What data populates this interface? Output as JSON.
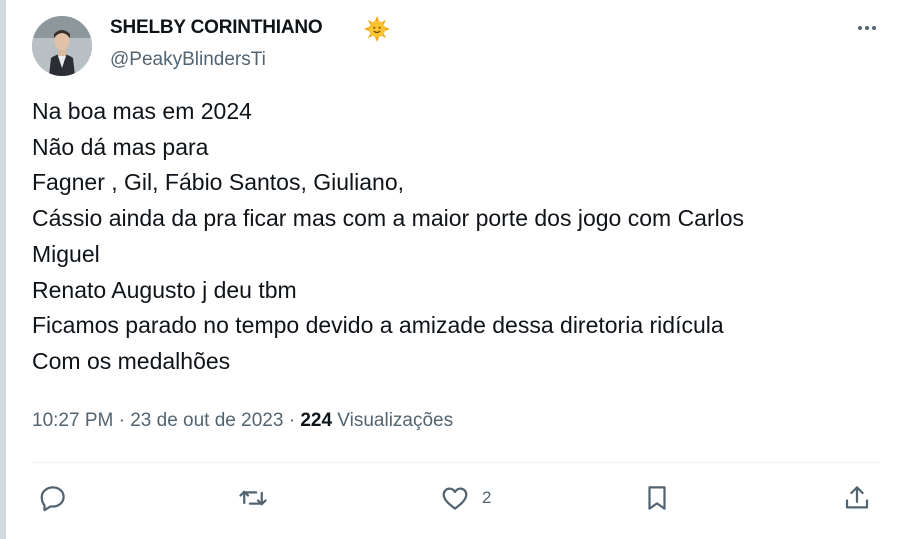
{
  "author": {
    "display_name": "SHELBY CORINTHIANO",
    "name_emoji": "sun-with-face-emoji",
    "handle": "@PeakyBlindersTi",
    "avatar": "profile-avatar"
  },
  "tweet": {
    "lines": [
      "Na boa mas em 2024",
      "Não dá mas para",
      "Fagner , Gil, Fábio Santos,  Giuliano,",
      "Cássio ainda da pra ficar mas com a maior porte dos jogo com Carlos",
      "Miguel",
      "Renato Augusto j deu tbm",
      "Ficamos parado no tempo devido a amizade dessa diretoria ridícula",
      "Com os medalhões"
    ]
  },
  "meta": {
    "time": "10:27 PM",
    "separator": " · ",
    "date": "23 de out de 2023",
    "views_count": "224",
    "views_label": " Visualizações"
  },
  "actions": {
    "reply_icon": "reply-icon",
    "retweet_icon": "retweet-icon",
    "like_icon": "like-icon",
    "like_count": "2",
    "bookmark_icon": "bookmark-icon",
    "share_icon": "share-icon",
    "more_icon": "more-icon"
  },
  "colors": {
    "text": "#0f1419",
    "secondary": "#536471",
    "divider": "#eff3f4"
  }
}
